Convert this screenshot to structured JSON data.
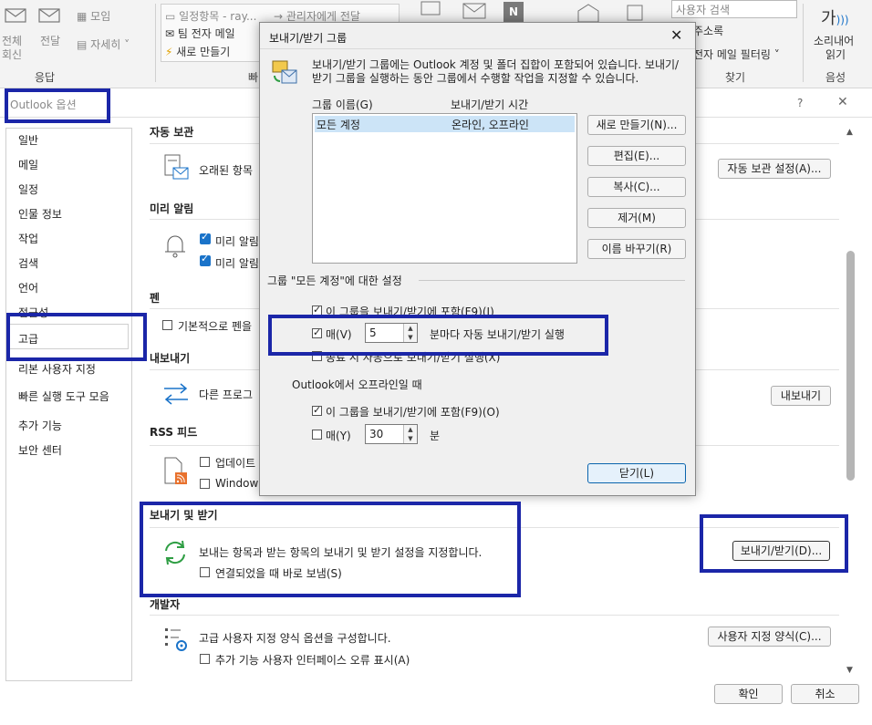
{
  "ribbon": {
    "reply_all": [
      "전체",
      "회신"
    ],
    "forward": "전달",
    "meeting": "모임",
    "more": "자세히",
    "respond_group": "응답",
    "quick_steps": [
      "일정항목 - ray...",
      "팀 전자 메일",
      "새로 만들기"
    ],
    "to_manager": "관리자에게 전달",
    "quick_group_partial": "빠",
    "search_people": "사용자 검색",
    "address_book": "주소록",
    "filter_email": "전자 메일 필터링",
    "find_group": "찾기",
    "read_aloud": [
      "소리내어",
      "읽기"
    ],
    "read_aloud_glyph": "가",
    "speech_group": "음성"
  },
  "options": {
    "title": "Outlook 옵션",
    "help": "?",
    "nav": [
      "일반",
      "메일",
      "일정",
      "인물 정보",
      "작업",
      "검색",
      "언어",
      "접근성",
      "고급",
      "리본 사용자 지정",
      "빠른 실행 도구 모음",
      "추가 기능",
      "보안 센터"
    ],
    "autoarchive": {
      "heading": "자동 보관",
      "desc": "오래된 항목",
      "button": "자동 보관 설정(A)..."
    },
    "reminders": {
      "heading": "미리 알림",
      "opt1": "미리 알림",
      "opt2": "미리 알림"
    },
    "pen": {
      "heading": "펜",
      "opt": "기본적으로 펜을"
    },
    "export": {
      "heading": "내보내기",
      "desc": "다른 프로그",
      "button": "내보내기"
    },
    "rss": {
      "heading": "RSS 피드",
      "opt1": "업데이트",
      "opt2": "Windows"
    },
    "send_receive": {
      "heading": "보내기 및 받기",
      "desc": "보내는 항목과 받는 항목의 보내기 및 받기 설정을 지정합니다.",
      "opt": "연결되었을 때 바로 보냄(S)",
      "button": "보내기/받기(D)..."
    },
    "developer": {
      "heading": "개발자",
      "desc": "고급 사용자 지정 양식 옵션을 구성합니다.",
      "opt": "추가 기능 사용자 인터페이스 오류 표시(A)",
      "button": "사용자 지정 양식(C)..."
    },
    "ok": "확인",
    "cancel": "취소"
  },
  "dialog": {
    "title": "보내기/받기 그룹",
    "description": "보내기/받기 그룹에는 Outlook 계정 및 폴더 집합이 포함되어 있습니다. 보내기/받기 그룹을 실행하는 동안 그룹에서 수행할 작업을 지정할 수 있습니다.",
    "col_name": "그룹 이름(G)",
    "col_time": "보내기/받기 시간",
    "rows": [
      {
        "name": "모든 계정",
        "time": "온라인, 오프라인"
      }
    ],
    "buttons": {
      "new": "새로 만들기(N)...",
      "edit": "편집(E)...",
      "copy": "복사(C)...",
      "remove": "제거(M)",
      "rename": "이름 바꾸기(R)"
    },
    "settings_title": "그룹 \"모든 계정\"에 대한 설정",
    "online": {
      "include": "이 그룹을 보내기/받기에 포함(F9)(I)",
      "every": "매(V)",
      "minutes_value": "5",
      "minutes_suffix": "분마다 자동 보내기/받기 실행",
      "on_exit": "종료 시 자동으로 보내기/받기 실행(X)"
    },
    "offline_title": "Outlook에서 오프라인일 때",
    "offline": {
      "include": "이 그룹을 보내기/받기에 포함(F9)(O)",
      "every": "매(Y)",
      "minutes_value": "30",
      "minutes_suffix": "분"
    },
    "close": "닫기(L)"
  },
  "colors": {
    "highlight": "#1b26a8",
    "selection": "#cce4f7",
    "check_blue": "#1a73c9"
  }
}
